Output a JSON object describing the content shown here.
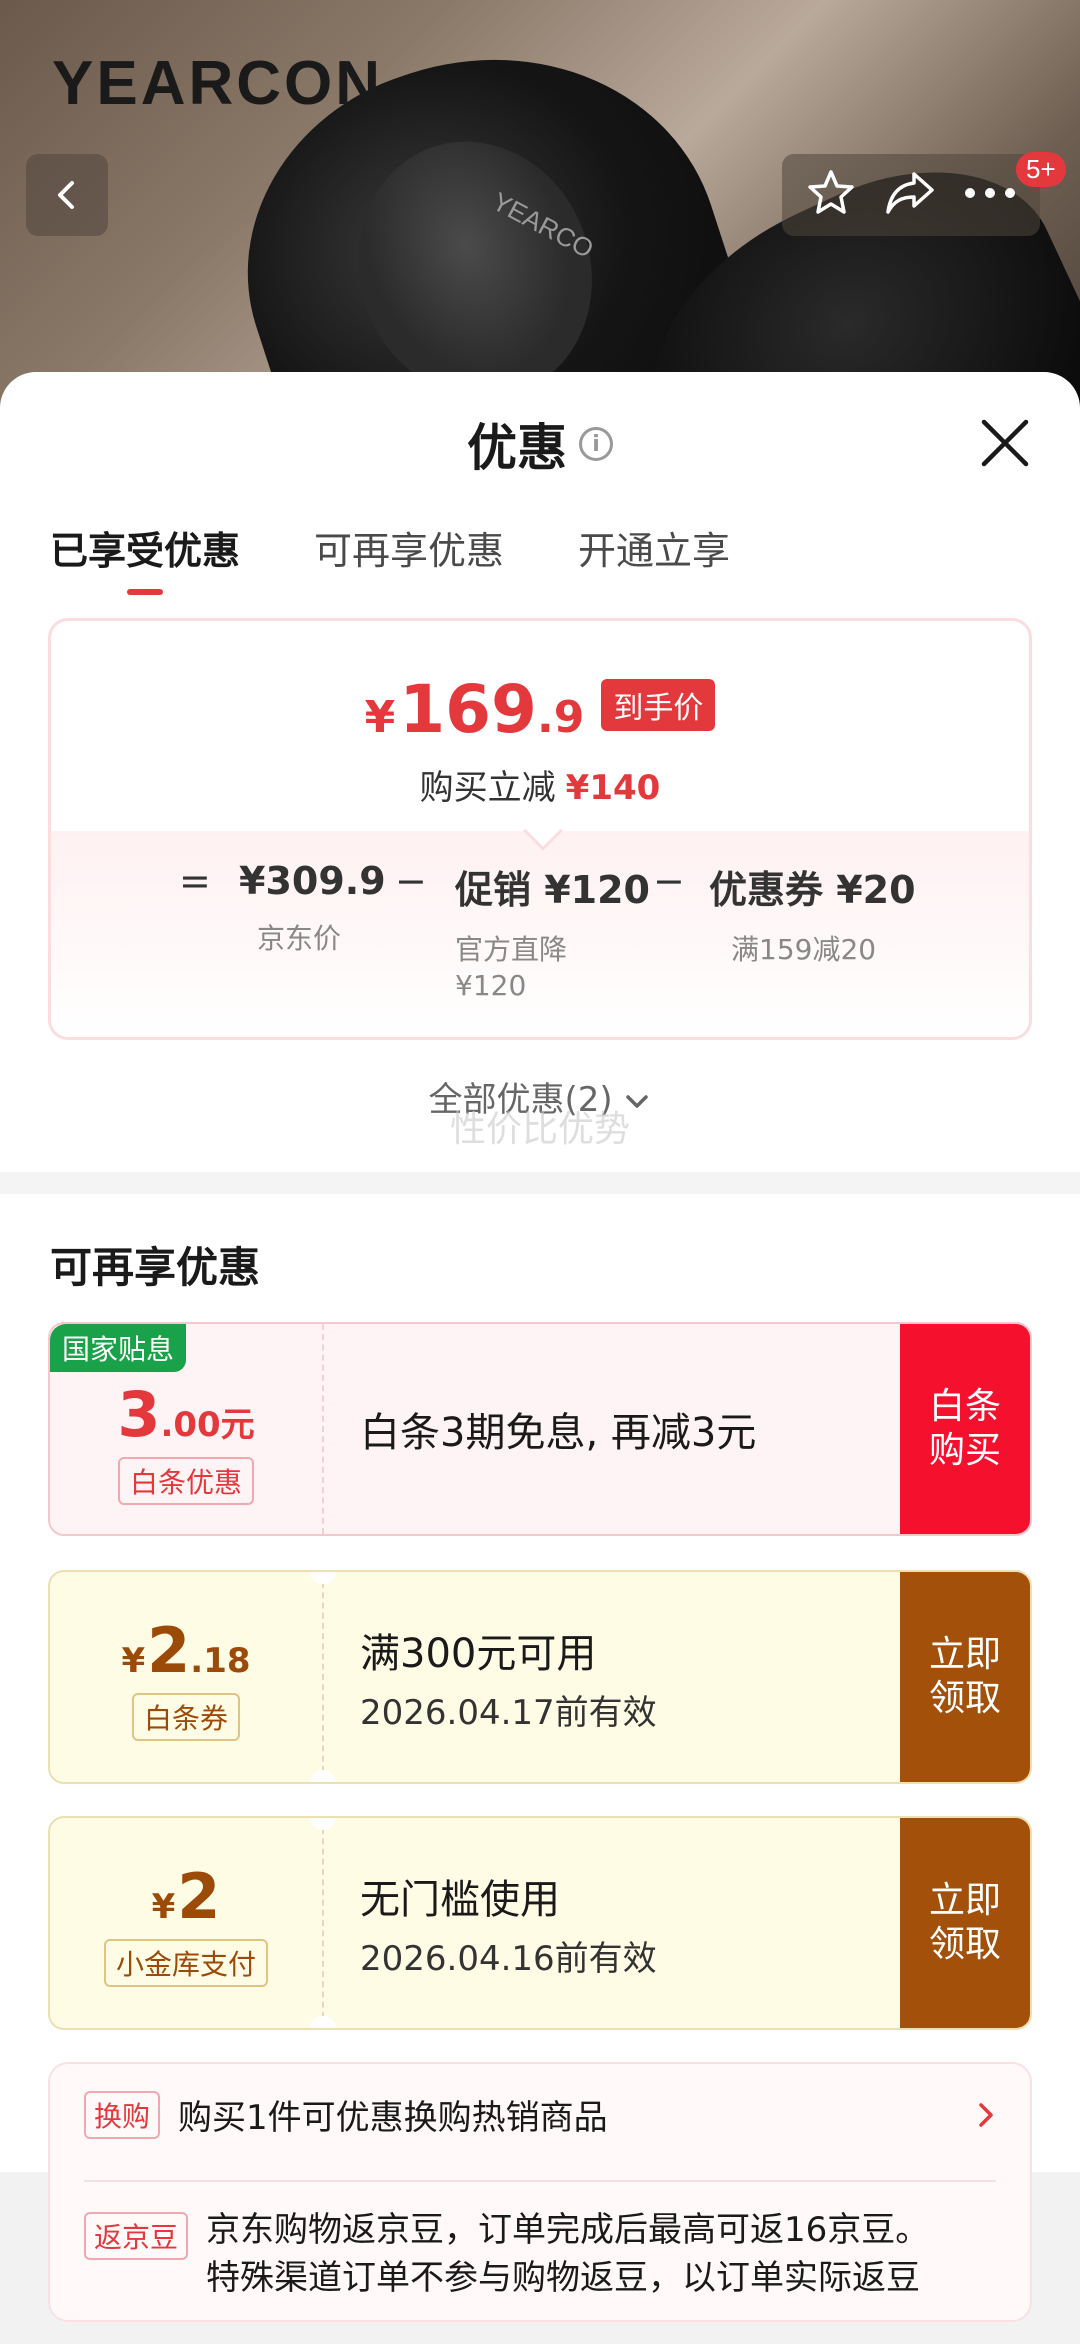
{
  "hero": {
    "brand": "YEARCON",
    "shoe_logo": "YEARCO",
    "cart_badge": "5+"
  },
  "sheet": {
    "title": "优惠",
    "info_glyph": "i",
    "tabs": [
      {
        "label": "已享受优惠",
        "active": true
      },
      {
        "label": "可再享优惠",
        "active": false
      },
      {
        "label": "开通立享",
        "active": false
      }
    ]
  },
  "summary": {
    "price_yen": "¥",
    "price_int": "169",
    "price_dec": ".9",
    "price_tag": "到手价",
    "reduce_label": "购买立减",
    "reduce_amount": "¥140",
    "eq": "=",
    "minus": "−",
    "jd_price": "¥309.9",
    "jd_price_label": "京东价",
    "promo": "促销 ¥120",
    "promo_label_1": "官方直降",
    "promo_label_2": "¥120",
    "coupon": "优惠券 ¥20",
    "coupon_label": "满159减20"
  },
  "all_deals": "全部优惠(2)",
  "watermark": "性价比优势",
  "more_section": {
    "title": "可再享优惠",
    "coupons": [
      {
        "corner": "国家贴息",
        "amt_int": "3",
        "amt_small": ".00元",
        "type": "白条优惠",
        "desc": "白条3期免息, 再减3元",
        "cta_1": "白条",
        "cta_2": "购买"
      },
      {
        "yen": "¥",
        "amt_int": "2",
        "amt_small": ".18",
        "type": "白条券",
        "desc": "满300元可用",
        "date": "2026.04.17前有效",
        "cta_1": "立即",
        "cta_2": "领取"
      },
      {
        "yen": "¥",
        "amt_int": "2",
        "type": "小金库支付",
        "desc": "无门槛使用",
        "date": "2026.04.16前有效",
        "cta_1": "立即",
        "cta_2": "领取"
      }
    ]
  },
  "extra": {
    "row1_tag": "换购",
    "row1_text": "购买1件可优惠换购热销商品",
    "row2_tag": "返京豆",
    "row2_text_1": "京东购物返京豆，订单完成后最高可返16京豆。",
    "row2_text_2": "特殊渠道订单不参与购物返豆，以订单实际返豆"
  }
}
